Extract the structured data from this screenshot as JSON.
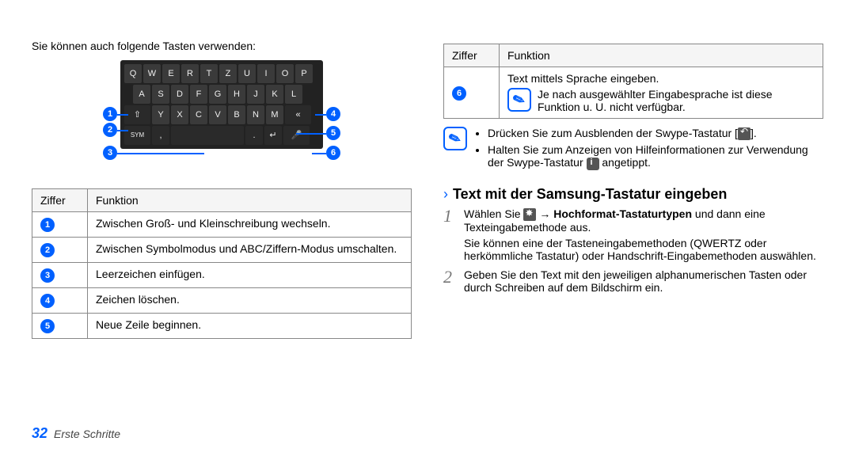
{
  "left": {
    "intro": "Sie können auch folgende Tasten verwenden:",
    "keyboard_rows": [
      [
        "Q",
        "W",
        "E",
        "R",
        "T",
        "Z",
        "U",
        "I",
        "O",
        "P"
      ],
      [
        "A",
        "S",
        "D",
        "F",
        "G",
        "H",
        "J",
        "K",
        "L"
      ],
      [
        "⇧",
        "Y",
        "X",
        "C",
        "V",
        "B",
        "N",
        "M",
        "⌫"
      ],
      [
        "SYM",
        "",
        "",
        ".",
        "␠",
        ",",
        "↵",
        "🎤"
      ]
    ],
    "callouts": [
      "1",
      "2",
      "3",
      "4",
      "5",
      "6"
    ],
    "table_header": {
      "col1": "Ziffer",
      "col2": "Funktion"
    },
    "rows": [
      {
        "num": "1",
        "text": "Zwischen Groß- und Kleinschreibung wechseln."
      },
      {
        "num": "2",
        "text": "Zwischen Symbolmodus und ABC/Ziffern-Modus umschalten."
      },
      {
        "num": "3",
        "text": "Leerzeichen einfügen."
      },
      {
        "num": "4",
        "text": "Zeichen löschen."
      },
      {
        "num": "5",
        "text": "Neue Zeile beginnen."
      }
    ]
  },
  "right": {
    "table_header": {
      "col1": "Ziffer",
      "col2": "Funktion"
    },
    "row6": {
      "num": "6",
      "line1": "Text mittels Sprache eingeben.",
      "note": "Je nach ausgewählter Eingabesprache ist diese Funktion u. U. nicht verfügbar."
    },
    "tips": [
      {
        "pre": "Drücken Sie zum Ausblenden der Swype-Tastatur [",
        "post": "]."
      },
      {
        "pre": "Halten Sie zum Anzeigen von Hilfeinformationen zur Verwendung der Swype-Tastatur ",
        "post": " angetippt."
      }
    ],
    "section_title": "Text mit der Samsung-Tastatur eingeben",
    "steps": [
      {
        "num": "1",
        "parts": {
          "a": "Wählen Sie ",
          "b": " → ",
          "bold": "Hochformat-Tastaturtypen",
          "c": " und dann eine Texteingabemethode aus.",
          "note": "Sie können eine der Tasteneingabemethoden (QWERTZ oder herkömmliche Tastatur) oder Handschrift-Eingabemethoden auswählen."
        }
      },
      {
        "num": "2",
        "text": "Geben Sie den Text mit den jeweiligen alphanumerischen Tasten oder durch Schreiben auf dem Bildschirm ein."
      }
    ]
  },
  "footer": {
    "page": "32",
    "text": "Erste Schritte"
  }
}
